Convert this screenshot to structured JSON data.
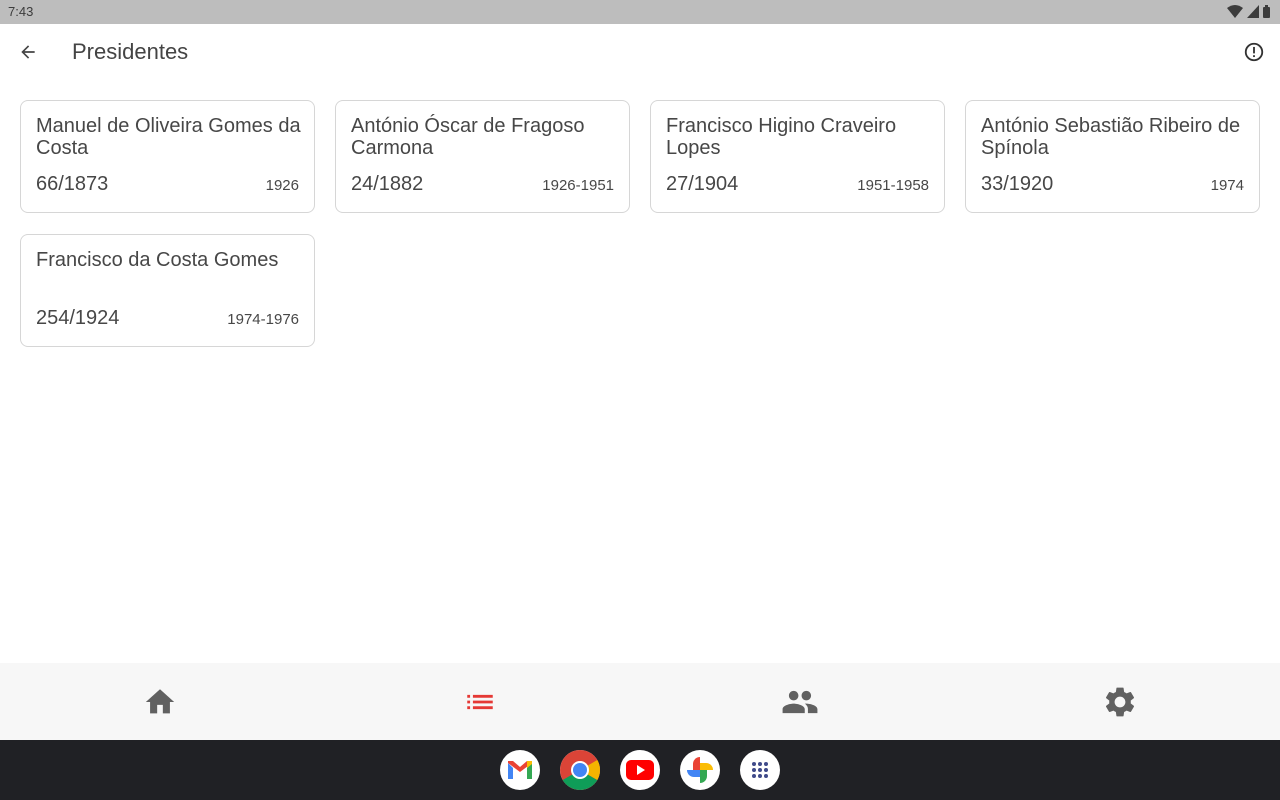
{
  "status_bar": {
    "time": "7:43"
  },
  "app_bar": {
    "title": "Presidentes"
  },
  "presidents": [
    {
      "name": "Manuel de Oliveira Gomes da Costa",
      "code": "66/1873",
      "years": "1926"
    },
    {
      "name": "António Óscar de Fragoso Carmona",
      "code": "24/1882",
      "years": "1926-1951"
    },
    {
      "name": "Francisco Higino Craveiro Lopes",
      "code": "27/1904",
      "years": "1951-1958"
    },
    {
      "name": "António Sebastião Ribeiro de Spínola",
      "code": "33/1920",
      "years": "1974"
    },
    {
      "name": "Francisco da Costa Gomes",
      "code": "254/1924",
      "years": "1974-1976"
    }
  ],
  "bottom_nav": {
    "items": [
      {
        "icon": "home-icon",
        "selected": false
      },
      {
        "icon": "list-icon",
        "selected": true
      },
      {
        "icon": "people-icon",
        "selected": false
      },
      {
        "icon": "settings-icon",
        "selected": false
      }
    ]
  },
  "dock": {
    "apps": [
      "gmail-icon",
      "chrome-icon",
      "youtube-icon",
      "photos-icon",
      "app-drawer-icon"
    ]
  },
  "colors": {
    "accent": "#e53935",
    "icon_default": "#616161",
    "card_border": "#d6d6d6",
    "status_bar": "#bdbdbd",
    "bottom_nav": "#f7f7f7",
    "system_bar": "#202125"
  }
}
